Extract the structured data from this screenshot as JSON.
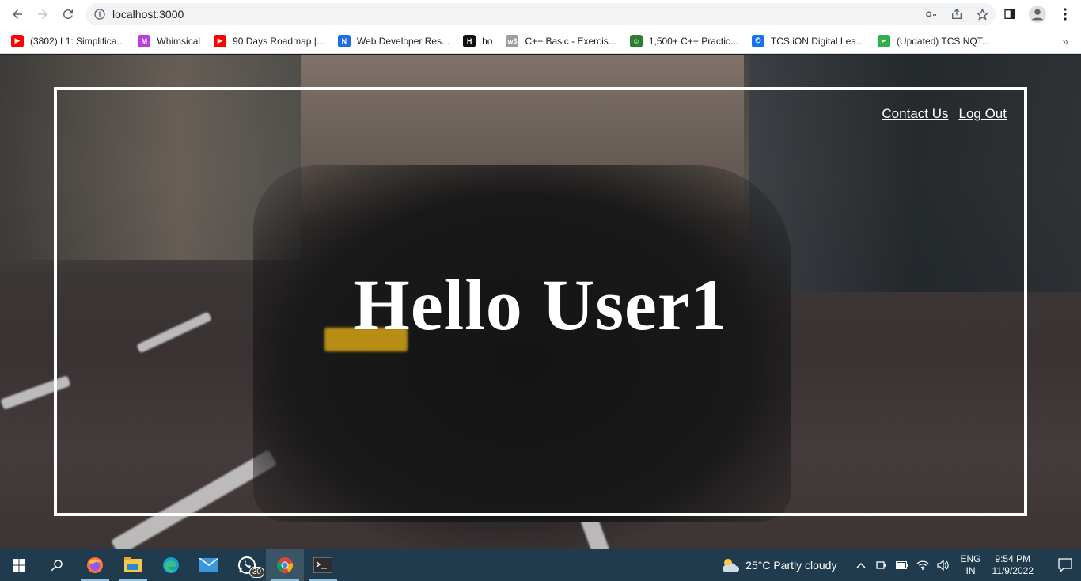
{
  "browser": {
    "url": "localhost:3000",
    "bookmarks": [
      {
        "label": "(3802) L1: Simplifica...",
        "icon": "youtube-icon",
        "color": "#ff0000",
        "glyph": "▶"
      },
      {
        "label": "Whimsical",
        "icon": "whimsical-icon",
        "color": "#b93ee0",
        "glyph": "M"
      },
      {
        "label": "90 Days Roadmap |...",
        "icon": "youtube-icon",
        "color": "#ff0000",
        "glyph": "▶"
      },
      {
        "label": "Web Developer Res...",
        "icon": "notion-style-icon",
        "color": "#1d6ee6",
        "glyph": "N"
      },
      {
        "label": "ho",
        "icon": "hackerrank-style-icon",
        "color": "#111111",
        "glyph": "H"
      },
      {
        "label": "C++ Basic - Exercis...",
        "icon": "w3resource-icon",
        "color": "#9e9e9e",
        "glyph": "w3"
      },
      {
        "label": "1,500+ C++ Practic...",
        "icon": "practice-site-icon",
        "color": "#2e7d32",
        "glyph": "☺"
      },
      {
        "label": "TCS iON Digital Lea...",
        "icon": "power-icon",
        "color": "#1a73e8",
        "glyph": "⏻"
      },
      {
        "label": "(Updated) TCS NQT...",
        "icon": "play-badge-icon",
        "color": "#2db24a",
        "glyph": "▸"
      }
    ],
    "more": "»"
  },
  "page": {
    "nav": {
      "contact": "Contact Us",
      "logout": "Log Out"
    },
    "greeting": "Hello User1"
  },
  "taskbar": {
    "whatsapp_badge": "30",
    "weather": "25°C  Partly cloudy",
    "lang_top": "ENG",
    "lang_bottom": "IN",
    "time": "9:54 PM",
    "date": "11/9/2022"
  }
}
